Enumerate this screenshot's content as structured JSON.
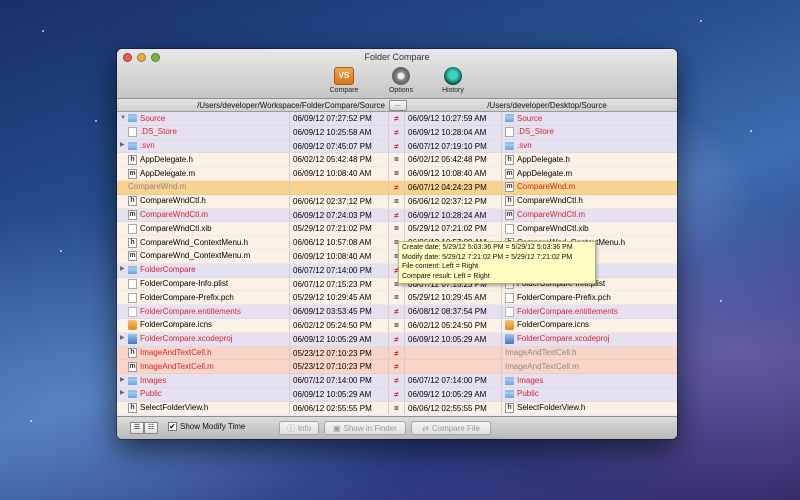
{
  "window": {
    "title": "Folder Compare"
  },
  "toolbar": {
    "compare_label": "Compare",
    "compare_icon_text": "VS",
    "options_label": "Options",
    "history_label": "History"
  },
  "paths": {
    "left": "/Users/developer/Workspace/FolderCompare/Source",
    "browse_label": "...",
    "right": "/Users/developer/Desktop/Source"
  },
  "rows": [
    {
      "bg": "purple",
      "disc": "▼",
      "licon": "folder",
      "lname": "Source",
      "lnc": "red",
      "ldate": "06/09/12 07:27:52 PM",
      "cmp": "≠",
      "rdate": "06/09/12 10:27:59 AM",
      "ricon": "folder",
      "rname": "Source",
      "rnc": "red"
    },
    {
      "bg": "purple",
      "disc": "",
      "licon": "file",
      "lname": ".DS_Store",
      "lnc": "red",
      "ldate": "06/09/12 10:25:58 AM",
      "cmp": "≠",
      "rdate": "06/09/12 10:28:04 AM",
      "ricon": "file",
      "rname": ".DS_Store",
      "rnc": "red"
    },
    {
      "bg": "purple",
      "disc": "▶",
      "licon": "folder",
      "lname": ".svn",
      "lnc": "red",
      "ldate": "06/09/12 07:45:07 PM",
      "cmp": "≠",
      "rdate": "06/07/12 07:19:10 PM",
      "ricon": "folder",
      "rname": ".svn",
      "rnc": "red"
    },
    {
      "bg": "cream",
      "disc": "",
      "licon": "hfile",
      "lname": "AppDelegate.h",
      "lnc": "",
      "ldate": "06/02/12 05:42:48 PM",
      "cmp": "=",
      "rdate": "06/02/12 05:42:48 PM",
      "ricon": "hfile",
      "rname": "AppDelegate.h",
      "rnc": ""
    },
    {
      "bg": "cream",
      "disc": "",
      "licon": "mfile",
      "lname": "AppDelegate.m",
      "lnc": "",
      "ldate": "06/09/12 10:08:40 AM",
      "cmp": "=",
      "rdate": "06/09/12 10:08:40 AM",
      "ricon": "mfile",
      "rname": "AppDelegate.m",
      "rnc": ""
    },
    {
      "bg": "orange",
      "disc": "",
      "licon": "",
      "lname": "CompareWnd.m",
      "lnc": "gray",
      "ldate": "",
      "cmp": "≠",
      "rdate": "06/07/12 04:24:23 PM",
      "ricon": "mfile",
      "rname": "CompareWnd.m",
      "rnc": "red"
    },
    {
      "bg": "cream",
      "disc": "",
      "licon": "hfile",
      "lname": "CompareWndCtl.h",
      "lnc": "",
      "ldate": "06/06/12 02:37:12 PM",
      "cmp": "=",
      "rdate": "06/06/12 02:37:12 PM",
      "ricon": "hfile",
      "rname": "CompareWndCtl.h",
      "rnc": ""
    },
    {
      "bg": "purple",
      "disc": "",
      "licon": "mfile",
      "lname": "CompareWndCtl.m",
      "lnc": "red",
      "ldate": "06/09/12 07:24:03 PM",
      "cmp": "≠",
      "rdate": "06/09/12 10:28:24 AM",
      "ricon": "mfile",
      "rname": "CompareWndCtl.m",
      "rnc": "red"
    },
    {
      "bg": "cream",
      "disc": "",
      "licon": "file",
      "lname": "CompareWndCtl.xib",
      "lnc": "",
      "ldate": "05/29/12 07:21:02 PM",
      "cmp": "=",
      "rdate": "05/29/12 07:21:02 PM",
      "ricon": "file",
      "rname": "CompareWndCtl.xib",
      "rnc": ""
    },
    {
      "bg": "cream",
      "disc": "",
      "licon": "hfile",
      "lname": "CompareWnd_ContextMenu.h",
      "lnc": "",
      "ldate": "06/06/12 10:57:08 AM",
      "cmp": "=",
      "rdate": "06/06/12 10:57:08 AM",
      "ricon": "hfile",
      "rname": "CompareWnd_ContextMenu.h",
      "rnc": ""
    },
    {
      "bg": "cream",
      "disc": "",
      "licon": "mfile",
      "lname": "CompareWnd_ContextMenu.m",
      "lnc": "",
      "ldate": "06/09/12 10:08:40 AM",
      "cmp": "=",
      "rdate": "",
      "ricon": "",
      "rname": "",
      "rnc": ""
    },
    {
      "bg": "purple",
      "disc": "▶",
      "licon": "folder",
      "lname": "FolderCompare",
      "lnc": "red",
      "ldate": "06/07/12 07:14:00 PM",
      "cmp": "≠",
      "rdate": "",
      "ricon": "",
      "rname": "",
      "rnc": ""
    },
    {
      "bg": "cream",
      "disc": "",
      "licon": "file",
      "lname": "FolderCompare-Info.plist",
      "lnc": "",
      "ldate": "06/07/12 07:15:23 PM",
      "cmp": "=",
      "rdate": "06/07/12 07:15:23 PM",
      "ricon": "file",
      "rname": "FolderCompare-Info.plist",
      "rnc": ""
    },
    {
      "bg": "cream",
      "disc": "",
      "licon": "file",
      "lname": "FolderCompare-Prefix.pch",
      "lnc": "",
      "ldate": "05/29/12 10:29:45 AM",
      "cmp": "=",
      "rdate": "05/29/12 10:29:45 AM",
      "ricon": "file",
      "rname": "FolderCompare-Prefix.pch",
      "rnc": ""
    },
    {
      "bg": "purple",
      "disc": "",
      "licon": "ent",
      "lname": "FolderCompare.entitlements",
      "lnc": "red",
      "ldate": "06/09/12 03:53:45 PM",
      "cmp": "≠",
      "rdate": "06/08/12 08:37:54 PM",
      "ricon": "ent",
      "rname": "FolderCompare.entitlements",
      "rnc": "red"
    },
    {
      "bg": "cream",
      "disc": "",
      "licon": "icns",
      "lname": "FolderCompare.icns",
      "lnc": "",
      "ldate": "06/02/12 05:24:50 PM",
      "cmp": "=",
      "rdate": "06/02/12 05:24:50 PM",
      "ricon": "icns",
      "rname": "FolderCompare.icns",
      "rnc": ""
    },
    {
      "bg": "purple",
      "disc": "▶",
      "licon": "proj",
      "lname": "FolderCompare.xcodeproj",
      "lnc": "red",
      "ldate": "06/09/12 10:05:29 AM",
      "cmp": "≠",
      "rdate": "06/09/12 10:05:29 AM",
      "ricon": "proj",
      "rname": "FolderCompare.xcodeproj",
      "rnc": "red"
    },
    {
      "bg": "salmon",
      "disc": "",
      "licon": "hfile",
      "lname": "ImageAndTextCell.h",
      "lnc": "red",
      "ldate": "05/23/12 07:10:23 PM",
      "cmp": "≠",
      "rdate": "",
      "ricon": "",
      "rname": "ImageAndTextCell.h",
      "rnc": "gray"
    },
    {
      "bg": "salmon",
      "disc": "",
      "licon": "mfile",
      "lname": "ImageAndTextCell.m",
      "lnc": "red",
      "ldate": "05/23/12 07:10:23 PM",
      "cmp": "≠",
      "rdate": "",
      "ricon": "",
      "rname": "ImageAndTextCell.m",
      "rnc": "gray"
    },
    {
      "bg": "purple",
      "disc": "▶",
      "licon": "folder",
      "lname": "Images",
      "lnc": "red",
      "ldate": "06/07/12 07:14:00 PM",
      "cmp": "≠",
      "rdate": "06/07/12 07:14:00 PM",
      "ricon": "folder",
      "rname": "Images",
      "rnc": "red"
    },
    {
      "bg": "purple",
      "disc": "▶",
      "licon": "folder",
      "lname": "Public",
      "lnc": "red",
      "ldate": "06/09/12 10:05:29 AM",
      "cmp": "≠",
      "rdate": "06/09/12 10:05:29 AM",
      "ricon": "folder",
      "rname": "Public",
      "rnc": "red"
    },
    {
      "bg": "cream",
      "disc": "",
      "licon": "hfile",
      "lname": "SelectFolderView.h",
      "lnc": "",
      "ldate": "06/06/12 02:55:55 PM",
      "cmp": "=",
      "rdate": "06/06/12 02:55:55 PM",
      "ricon": "hfile",
      "rname": "SelectFolderView.h",
      "rnc": ""
    }
  ],
  "tooltip": {
    "create": "Create date: 5/29/12 5:03:36 PM = 5/29/12 5:03:36 PM",
    "modify": "Modify date: 5/29/12 7:21:02 PM = 5/29/12 7:21:02 PM",
    "content": "File content: Left = Right",
    "result": "Compare result: Left = Right"
  },
  "statusbar": {
    "view_list_icon": "☰",
    "view_detail_icon": "☷",
    "checkbox_mark": "✔",
    "show_modify_label": "Show Modify Time",
    "info_label": "Info",
    "show_in_finder_label": "Show in Finder",
    "compare_file_label": "Compare File"
  },
  "colors": {
    "diff_text": "#d8252e",
    "row_purple": "#e6e1f1",
    "row_cream": "#fbf1e6",
    "row_orange": "#f8d390",
    "row_salmon": "#f8d5c8"
  }
}
